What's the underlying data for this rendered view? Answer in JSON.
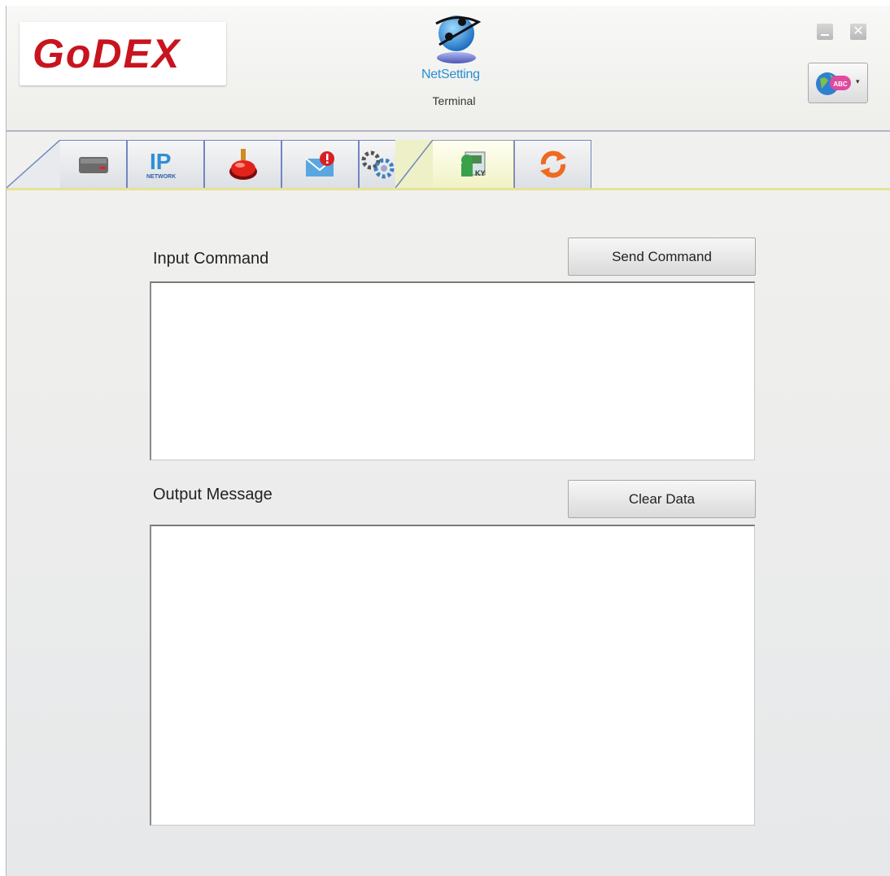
{
  "header": {
    "logo_text": "GoDEX",
    "app_name": "NetSetting",
    "page_caption": "Terminal",
    "window_controls": {
      "minimize_icon": "minimize-icon",
      "close_icon": "close-icon",
      "close_glyph": "✕"
    },
    "language_button": {
      "icon": "globe-abc-icon",
      "caret": "▾"
    }
  },
  "tabs": [
    {
      "id": "printer",
      "icon": "printer-icon",
      "active": false
    },
    {
      "id": "ip-network",
      "icon": "ip-network-icon",
      "active": false
    },
    {
      "id": "alert",
      "icon": "red-alarm-icon",
      "active": false
    },
    {
      "id": "mail-alert",
      "icon": "mail-alert-icon",
      "active": false
    },
    {
      "id": "settings",
      "icon": "gears-icon",
      "active": false
    },
    {
      "id": "terminal",
      "icon": "terminal-icon",
      "active": true
    },
    {
      "id": "update",
      "icon": "refresh-icon",
      "active": false
    }
  ],
  "terminal": {
    "input_label": "Input Command",
    "send_button": "Send Command",
    "input_value": "",
    "output_label": "Output Message",
    "clear_button": "Clear Data",
    "output_value": ""
  },
  "colors": {
    "tab_border": "#6f87c0",
    "active_tab": "#f1f2c6",
    "app_name": "#2a8fd0",
    "logo_red": "#c8141e"
  }
}
